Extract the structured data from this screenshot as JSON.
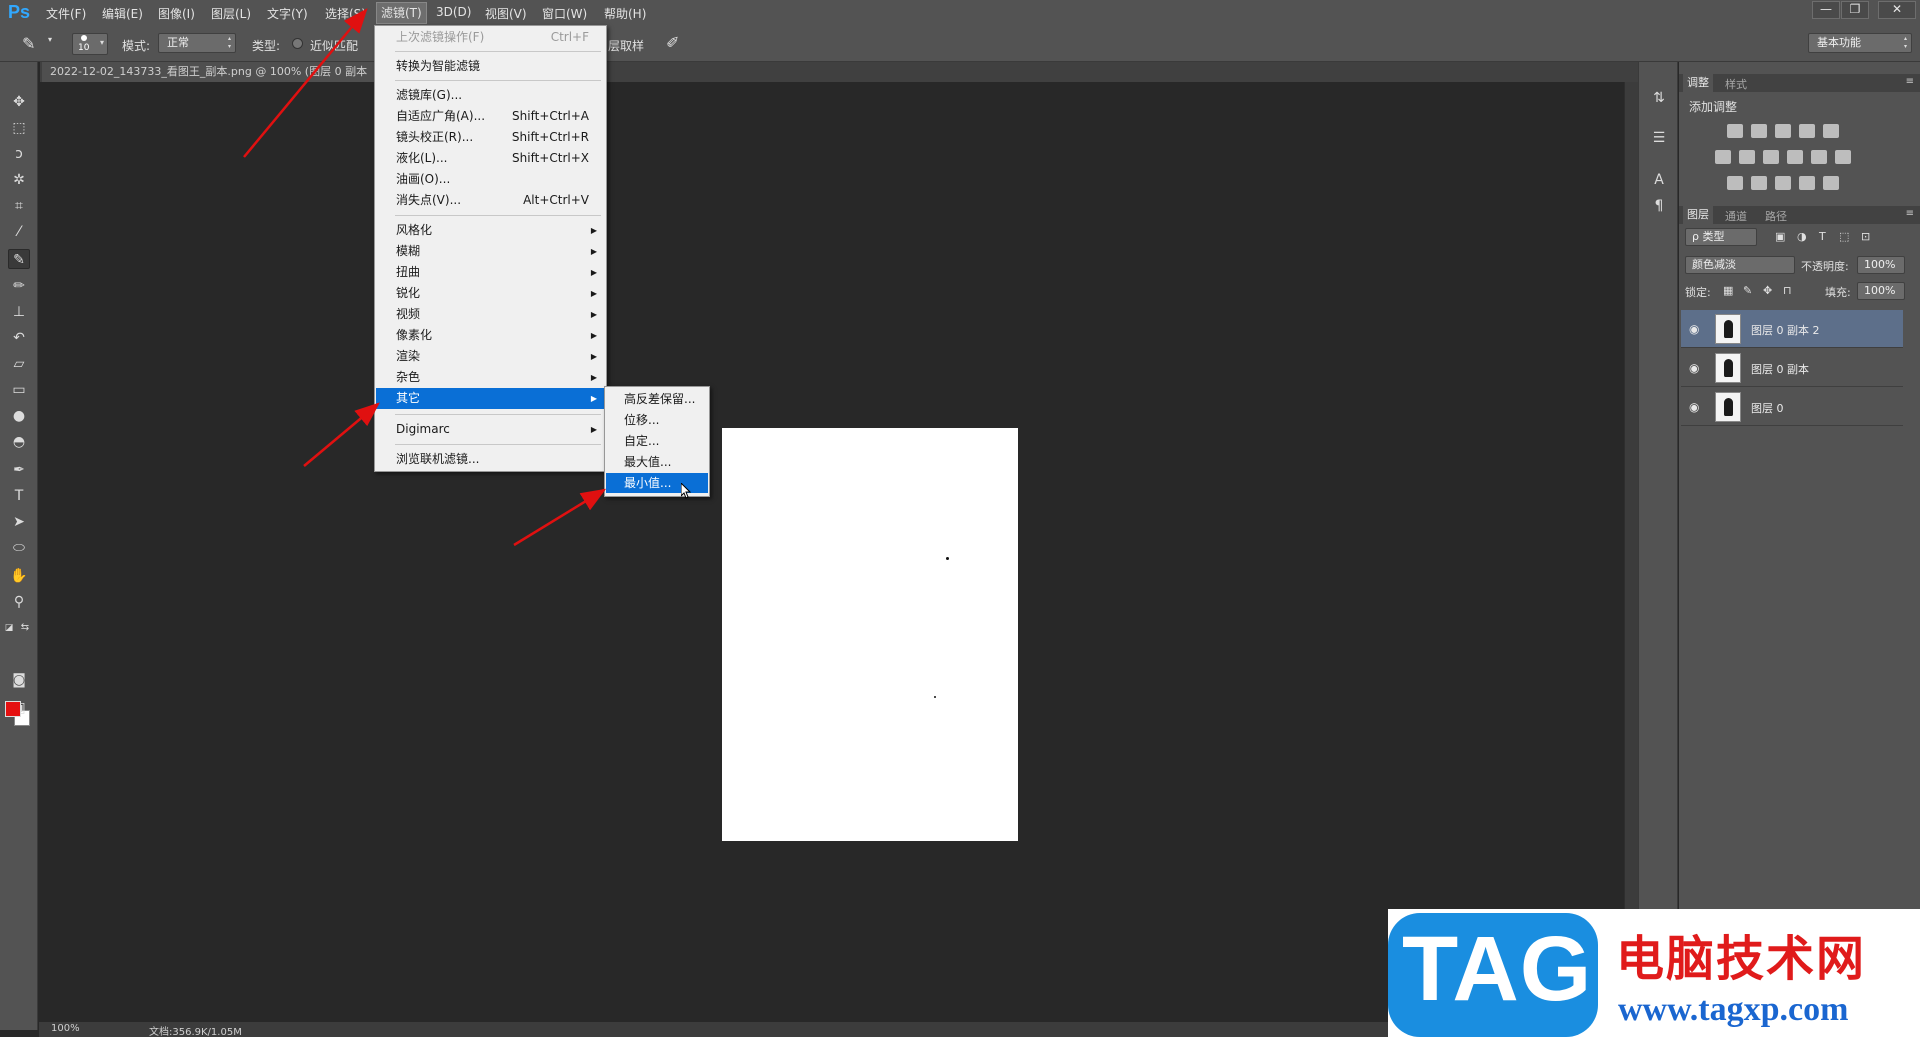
{
  "app": {
    "logo": "Ps",
    "menus": [
      "文件(F)",
      "编辑(E)",
      "图像(I)",
      "图层(L)",
      "文字(Y)",
      "选择(S)",
      "滤镜(T)",
      "3D(D)",
      "视图(V)",
      "窗口(W)",
      "帮助(H)"
    ],
    "window_buttons": [
      "—",
      "❐",
      "✕"
    ]
  },
  "options": {
    "brush_size": "10",
    "mode_label": "模式:",
    "mode_value": "正常",
    "type_label": "类型:",
    "type_option": "近似匹配",
    "sample_label": "层取样",
    "workspace": "基本功能"
  },
  "document": {
    "tab_title": "2022-12-02_143733_看图王_副本.png @ 100% (图层 0 副本"
  },
  "status": {
    "zoom": "100%",
    "doc_info": "文档:356.9K/1.05M"
  },
  "filter_menu": {
    "items": [
      {
        "label": "上次滤镜操作(F)",
        "shortcut": "Ctrl+F",
        "disabled": true
      },
      {
        "label": "转换为智能滤镜",
        "shortcut": ""
      },
      {
        "label": "滤镜库(G)...",
        "shortcut": ""
      },
      {
        "label": "自适应广角(A)...",
        "shortcut": "Shift+Ctrl+A"
      },
      {
        "label": "镜头校正(R)...",
        "shortcut": "Shift+Ctrl+R"
      },
      {
        "label": "液化(L)...",
        "shortcut": "Shift+Ctrl+X"
      },
      {
        "label": "油画(O)...",
        "shortcut": ""
      },
      {
        "label": "消失点(V)...",
        "shortcut": "Alt+Ctrl+V"
      },
      {
        "label": "风格化",
        "submenu": true
      },
      {
        "label": "模糊",
        "submenu": true
      },
      {
        "label": "扭曲",
        "submenu": true
      },
      {
        "label": "锐化",
        "submenu": true
      },
      {
        "label": "视频",
        "submenu": true
      },
      {
        "label": "像素化",
        "submenu": true
      },
      {
        "label": "渲染",
        "submenu": true
      },
      {
        "label": "杂色",
        "submenu": true
      },
      {
        "label": "其它",
        "submenu": true,
        "highlighted": true
      },
      {
        "label": "Digimarc",
        "submenu": true
      },
      {
        "label": "浏览联机滤镜...",
        "shortcut": ""
      }
    ]
  },
  "other_submenu": {
    "items": [
      "高反差保留...",
      "位移...",
      "自定...",
      "最大值...",
      "最小值..."
    ],
    "highlighted": "最小值..."
  },
  "panels": {
    "adjust_tabs": [
      "调整",
      "样式"
    ],
    "adjust_title": "添加调整",
    "layer_tabs": [
      "图层",
      "通道",
      "路径"
    ],
    "filter_kind": "ρ 类型",
    "blend_mode": "颜色减淡",
    "opacity_label": "不透明度:",
    "opacity_value": "100%",
    "lock_label": "锁定:",
    "fill_label": "填充:",
    "fill_value": "100%",
    "layers": [
      {
        "name": "图层 0 副本 2",
        "selected": true
      },
      {
        "name": "图层 0 副本",
        "selected": false
      },
      {
        "name": "图层 0",
        "selected": false
      }
    ]
  },
  "watermark": {
    "tag": "TAG",
    "title": "电脑技术网",
    "url": "www.tagxp.com"
  },
  "colors": {
    "accent_highlight": "#0a6fd6",
    "foreground_color": "#e51010",
    "background_color": "#ffffff",
    "annotation_arrow": "#e01010"
  },
  "icons": {
    "tools": [
      "move-icon",
      "marquee-icon",
      "lasso-icon",
      "magic-wand-icon",
      "crop-icon",
      "eyedropper-icon",
      "healing-brush-icon",
      "brush-icon",
      "clone-stamp-icon",
      "history-brush-icon",
      "eraser-icon",
      "gradient-icon",
      "blur-icon",
      "dodge-icon",
      "pen-icon",
      "type-icon",
      "path-select-icon",
      "ellipse-icon",
      "hand-icon",
      "zoom-icon"
    ]
  }
}
